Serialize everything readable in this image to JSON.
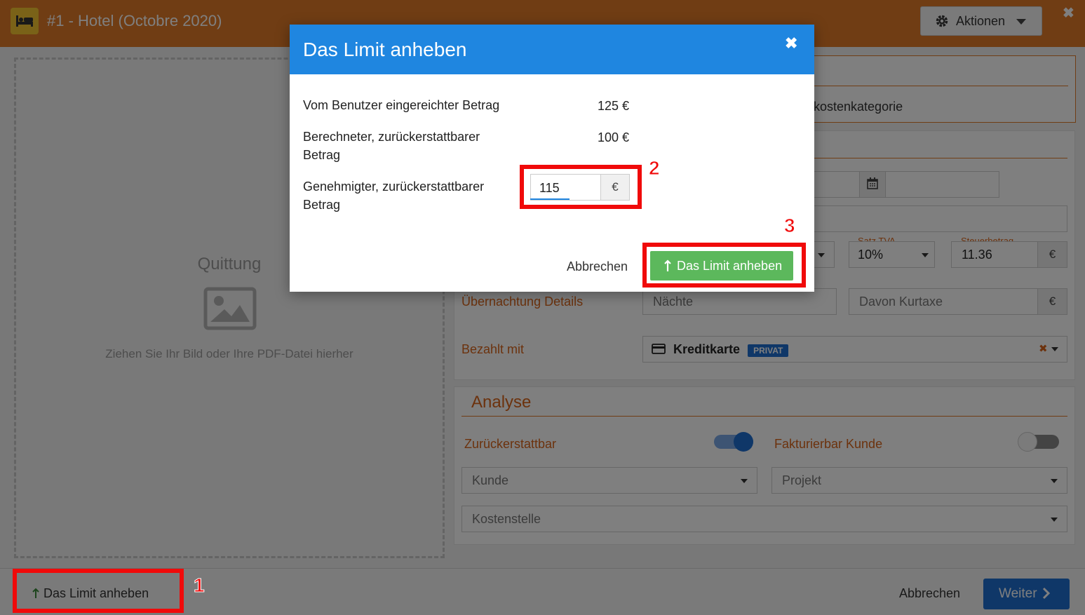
{
  "header": {
    "title": "#1 -  Hotel (Octobre 2020)",
    "actions_label": "Aktionen"
  },
  "dropzone": {
    "title": "Quittung",
    "hint": "Ziehen Sie Ihr Bild oder Ihre PDF-Datei hierher"
  },
  "form": {
    "category_fragment": "kostenkategorie",
    "satz_tva_label": "Satz TVA",
    "satz_tva_value": "10%",
    "steuerbetrag_label": "Steuerbetrag",
    "steuerbetrag_value": "11.36",
    "currency": "€",
    "uebernachtung_label": "Übernachtung Details",
    "naechte_placeholder": "Nächte",
    "kurtaxe_placeholder": "Davon Kurtaxe",
    "bezahlt_label": "Bezahlt mit",
    "bezahlt_value": "Kreditkarte",
    "bezahlt_badge": "PRIVAT"
  },
  "analyse": {
    "title": "Analyse",
    "zurueck_label": "Zurückerstattbar",
    "zurueck_on": true,
    "fakt_label": "Fakturierbar Kunde",
    "fakt_on": false,
    "kunde_placeholder": "Kunde",
    "projekt_placeholder": "Projekt",
    "kostenstelle_placeholder": "Kostenstelle"
  },
  "footer": {
    "limit_label": "Das Limit anheben",
    "cancel_label": "Abbrechen",
    "next_label": "Weiter"
  },
  "modal": {
    "title": "Das Limit anheben",
    "row1_label": "Vom Benutzer eingereichter Betrag",
    "row1_value": "125 €",
    "row2_label": "Berechneter, zurückerstattbarer Betrag",
    "row2_value": "100 €",
    "row3_label": "Genehmigter, zurückerstattbarer Betrag",
    "approved_value": "115",
    "currency": "€",
    "cancel_label": "Abbrechen",
    "confirm_label": "Das Limit anheben"
  },
  "annotations": [
    "1",
    "2",
    "3"
  ],
  "colors": {
    "header": "#e17a28",
    "modal_header": "#1f86e0",
    "confirm": "#5cb85c",
    "primary": "#1f6fd1",
    "annotation": "#f00a0a"
  }
}
